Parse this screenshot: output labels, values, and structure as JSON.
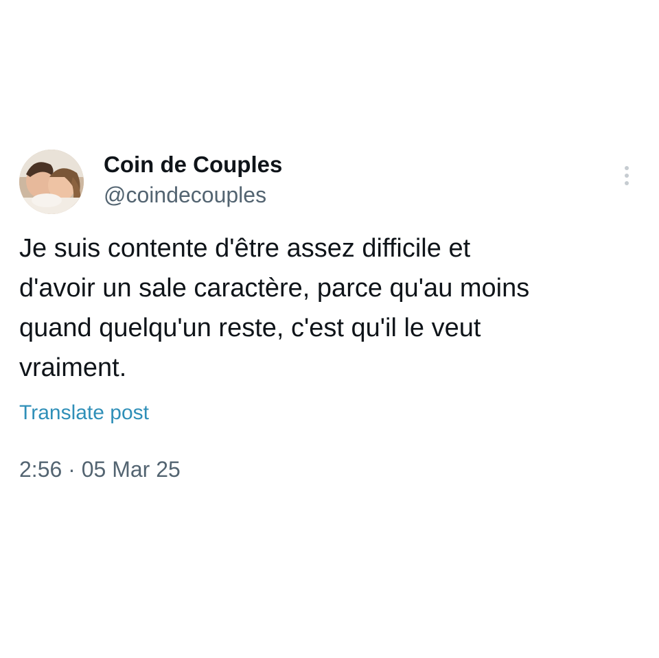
{
  "author": {
    "display_name": "Coin de Couples",
    "handle": "@coindecouples",
    "avatar_icon": "couple-photo-avatar"
  },
  "menu": {
    "icon": "more-vertical-icon"
  },
  "post": {
    "text": "Je suis contente d'être assez difficile et\nd'avoir un sale caractère, parce qu'au moins\nquand quelqu'un reste, c'est qu'il le veut\nvraiment.",
    "translate_label": "Translate post",
    "time": "2:56",
    "separator": "·",
    "date": "05 Mar 25"
  },
  "colors": {
    "text_primary": "#0f1419",
    "text_secondary": "#536471",
    "link": "#2f8fb8",
    "background": "#ffffff"
  }
}
